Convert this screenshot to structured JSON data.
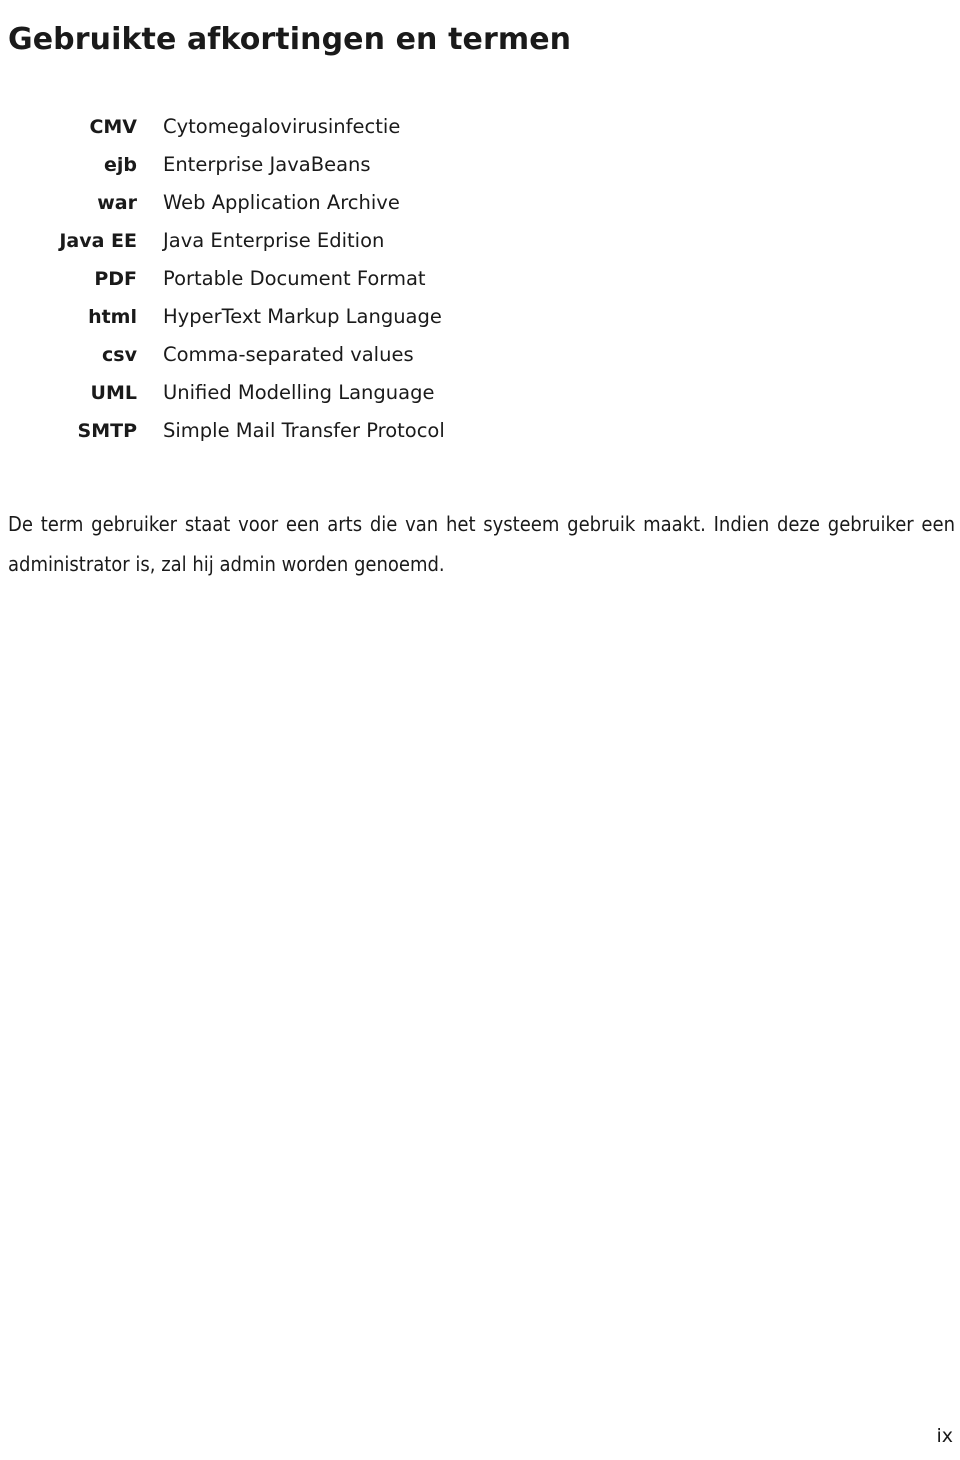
{
  "document": {
    "title": "Gebruikte afkortingen en termen",
    "abbreviations": [
      {
        "term": "CMV",
        "definition": "Cytomegalovirusinfectie"
      },
      {
        "term": "ejb",
        "definition": "Enterprise JavaBeans"
      },
      {
        "term": "war",
        "definition": "Web Application Archive"
      },
      {
        "term": "Java EE",
        "definition": "Java Enterprise Edition"
      },
      {
        "term": "PDF",
        "definition": "Portable Document Format"
      },
      {
        "term": "html",
        "definition": "HyperText Markup Language"
      },
      {
        "term": "csv",
        "definition": "Comma-separated values"
      },
      {
        "term": "UML",
        "definition": "Unified Modelling Language"
      },
      {
        "term": "SMTP",
        "definition": "Simple Mail Transfer Protocol"
      }
    ],
    "paragraph": "De term gebruiker staat voor een arts die van het systeem gebruik maakt. Indien deze gebruiker een administrator is, zal hij admin worden genoemd.",
    "page_number": "ix"
  }
}
